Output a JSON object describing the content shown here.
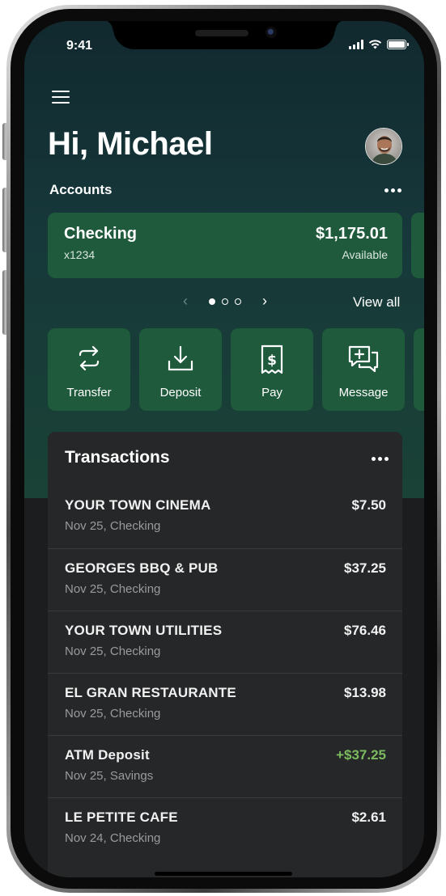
{
  "status_bar": {
    "time": "9:41"
  },
  "header": {
    "greeting": "Hi, Michael",
    "accounts_label": "Accounts"
  },
  "account": {
    "name": "Checking",
    "number": "x1234",
    "amount": "$1,175.01",
    "amount_label": "Available"
  },
  "pager": {
    "view_all": "View all",
    "page_count": 3,
    "active_page": 1
  },
  "actions": [
    {
      "label": "Transfer",
      "icon": "transfer-icon"
    },
    {
      "label": "Deposit",
      "icon": "deposit-icon"
    },
    {
      "label": "Pay",
      "icon": "bill-receipt-icon"
    },
    {
      "label": "Message",
      "icon": "message-icon"
    }
  ],
  "transactions": {
    "title": "Transactions",
    "items": [
      {
        "name": "YOUR TOWN CINEMA",
        "detail": "Nov 25, Checking",
        "amount": "$7.50",
        "credit": false
      },
      {
        "name": "GEORGES BBQ & PUB",
        "detail": "Nov 25, Checking",
        "amount": "$37.25",
        "credit": false
      },
      {
        "name": "YOUR TOWN UTILITIES",
        "detail": "Nov 25, Checking",
        "amount": "$76.46",
        "credit": false
      },
      {
        "name": "EL GRAN RESTAURANTE",
        "detail": "Nov 25, Checking",
        "amount": "$13.98",
        "credit": false
      },
      {
        "name": "ATM Deposit",
        "detail": "Nov 25, Savings",
        "amount": "+$37.25",
        "credit": true
      },
      {
        "name": "LE PETITE CAFE",
        "detail": "Nov 24, Checking",
        "amount": "$2.61",
        "credit": false
      }
    ]
  },
  "colors": {
    "card_green": "#1e5a3b",
    "credit_green": "#7cba5f",
    "panel": "#262728"
  }
}
